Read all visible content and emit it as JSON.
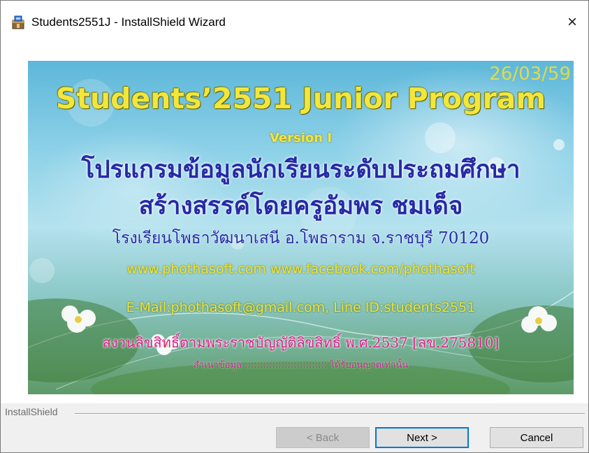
{
  "window": {
    "title": "Students2551J - InstallShield Wizard",
    "close_symbol": "×"
  },
  "banner": {
    "date": "26/03/59",
    "title": "Students’2551 Junior Program",
    "version": "Version I",
    "thai_line1": "โปรแกรมข้อมูลนักเรียนระดับประถมศึกษา",
    "thai_line2": "สร้างสรรค์โดยครูอัมพร  ชมเด็จ",
    "thai_line3": "โรงเรียนโพธาวัฒนาเสนี อ.โพธาราม จ.ราชบุรี 70120",
    "websites": "www.phothasoft.com   www.facebook.com/phothasoft",
    "contact": "E-Mail:phothasoft@gmail.com,   Line ID:students2551",
    "copyright": "สงวนลิขสิทธิ์ตามพระราชบัญญัติลิขสิทธิ์ พ.ศ.2537 [ลข.275810]",
    "note": "สำเนาข้อมูล ::::::::::::::::::::::::::: ได้รับอนุญาตเท่านั้น"
  },
  "footer": {
    "brand": "InstallShield",
    "back_label": "< Back",
    "next_label": "Next >",
    "cancel_label": "Cancel"
  },
  "colors": {
    "title_yellow": "#f2e63c",
    "thai_blue": "#262aa6",
    "copyright_pink": "#d81f8a",
    "focus_blue": "#0078d7"
  },
  "icons": {
    "app": "installer-package-icon",
    "close": "close-icon"
  }
}
